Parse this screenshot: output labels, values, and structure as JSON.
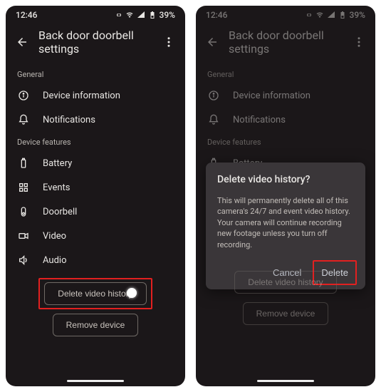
{
  "status": {
    "time": "12:46",
    "battery": "39%"
  },
  "header": {
    "title": "Back door doorbell settings"
  },
  "sections": {
    "general": "General",
    "features": "Device features"
  },
  "items": {
    "device_info": "Device information",
    "notifications": "Notifications",
    "battery": "Battery",
    "events": "Events",
    "doorbell": "Doorbell",
    "video": "Video",
    "audio": "Audio"
  },
  "actions": {
    "delete_history": "Delete video history",
    "remove_device": "Remove device"
  },
  "dialog": {
    "title": "Delete video history?",
    "body": "This will permanently delete all of this camera's 24/7 and event video history. Your camera will continue recording new footage unless you turn off recording.",
    "cancel": "Cancel",
    "delete": "Delete"
  }
}
